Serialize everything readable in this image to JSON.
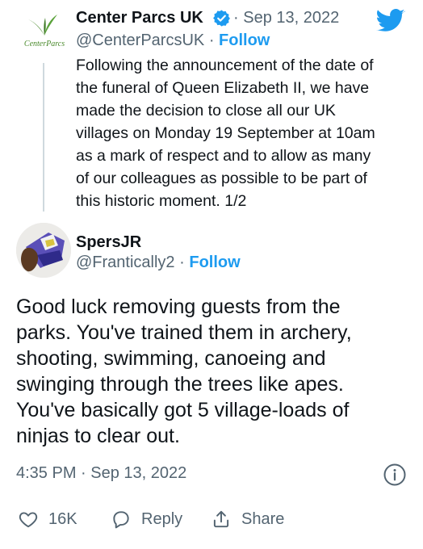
{
  "quoted_tweet": {
    "author_name": "Center Parcs UK",
    "logo_text": "CenterParcs",
    "separator": "·",
    "date": "Sep 13, 2022",
    "handle": "@CenterParcsUK",
    "follow_label": "Follow",
    "text": "Following the announcement of the date of\nthe funeral of Queen Elizabeth II, we have\nmade the decision to close all our UK\nvillages on Monday 19 September at 10am\nas a mark of respect and to allow as many\nof our colleagues as possible to be part of\nthis historic moment. 1/2",
    "verified_icon": "verified-badge-icon",
    "brand_icon": "twitter-bird-icon"
  },
  "reply_tweet": {
    "author_name": "SpersJR",
    "handle": "@Frantically2",
    "separator": "·",
    "follow_label": "Follow",
    "text": "Good luck removing guests from the\nparks. You've trained them in archery,\nshooting, swimming, canoeing and\nswinging through the trees like apes.\nYou've basically got 5 village-loads of\nninjas to clear out.",
    "timestamp": "4:35 PM · Sep 13, 2022"
  },
  "actions": {
    "likes_count": "16K",
    "reply_label": "Reply",
    "share_label": "Share"
  },
  "colors": {
    "accent": "#1d9bf0",
    "secondary_text": "#536471",
    "primary_text": "#0f1419",
    "logo_green": "#4a8a2c"
  }
}
